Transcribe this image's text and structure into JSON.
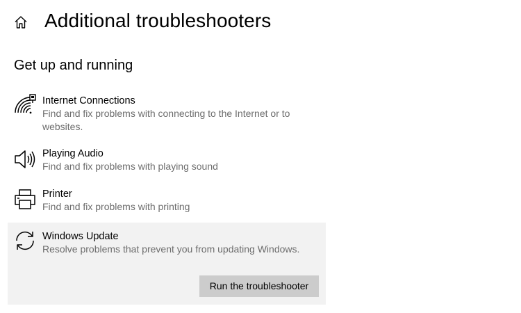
{
  "header": {
    "home_icon": "home-icon",
    "title": "Additional troubleshooters"
  },
  "section": {
    "title": "Get up and running"
  },
  "troubleshooters": [
    {
      "name": "Internet Connections",
      "description": "Find and fix problems with connecting to the Internet or to websites.",
      "icon": "wifi-ethernet-icon"
    },
    {
      "name": "Playing Audio",
      "description": "Find and fix problems with playing sound",
      "icon": "speaker-icon"
    },
    {
      "name": "Printer",
      "description": "Find and fix problems with printing",
      "icon": "printer-icon"
    },
    {
      "name": "Windows Update",
      "description": "Resolve problems that prevent you from updating Windows.",
      "icon": "sync-icon",
      "selected": true,
      "action_label": "Run the troubleshooter"
    }
  ],
  "colors": {
    "background": "#ffffff",
    "selected_background": "#f2f2f2",
    "button_background": "#cccccc",
    "secondary_text": "#6d6d6d"
  }
}
